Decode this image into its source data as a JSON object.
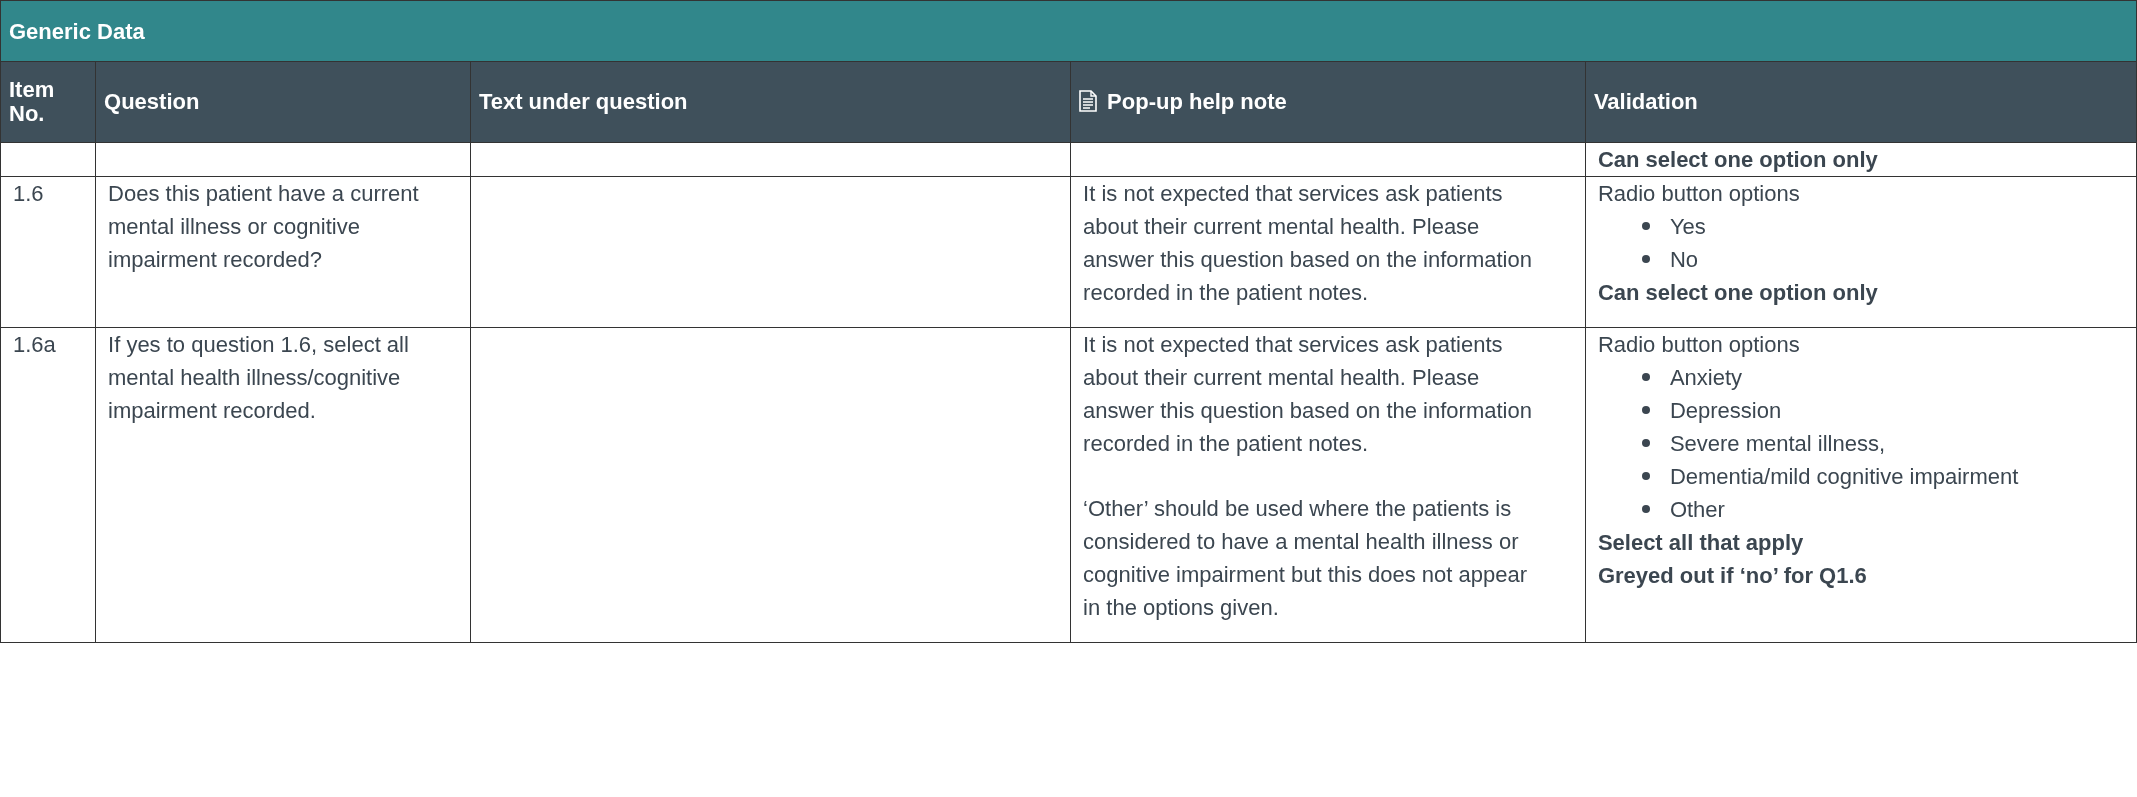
{
  "title": "Generic Data",
  "columns": [
    {
      "label": "Item No.",
      "has_icon": false
    },
    {
      "label": "Question",
      "has_icon": false
    },
    {
      "label": "Text under question",
      "has_icon": false
    },
    {
      "label": "Pop-up help note",
      "has_icon": true
    },
    {
      "label": "Validation",
      "has_icon": false
    }
  ],
  "rows": [
    {
      "validation": [
        {
          "kind": "note",
          "text": "Can select one option only"
        }
      ]
    },
    {
      "item": "1.6",
      "question": "Does this patient have a current mental illness or cognitive impairment recorded?",
      "help_note": [
        "It is not expected that services ask patients about their current mental health. Please answer this question based on the information recorded in the patient notes."
      ],
      "validation": [
        {
          "kind": "label",
          "text": "Radio button options"
        },
        {
          "kind": "list",
          "items": [
            "Yes",
            "No"
          ]
        },
        {
          "kind": "note",
          "text": "Can select one option only"
        }
      ]
    },
    {
      "item": "1.6a",
      "question": "If yes to question 1.6, select all mental health illness/cognitive impairment recorded.",
      "help_note": [
        "It is not expected that services ask patients about their current mental health. Please answer this question based on the information recorded in the patient notes.",
        "‘Other’ should be used where the patients is considered to have a mental health illness or cognitive impairment but this does not appear in the options given."
      ],
      "validation": [
        {
          "kind": "label",
          "text": "Radio button options"
        },
        {
          "kind": "list",
          "items": [
            "Anxiety",
            "Depression",
            "Severe mental illness,",
            "Dementia/mild cognitive impairment",
            "Other"
          ]
        },
        {
          "kind": "note",
          "text": "Select all that apply"
        },
        {
          "kind": "note",
          "text": "Greyed out if ‘no’ for Q1.6"
        }
      ]
    }
  ]
}
